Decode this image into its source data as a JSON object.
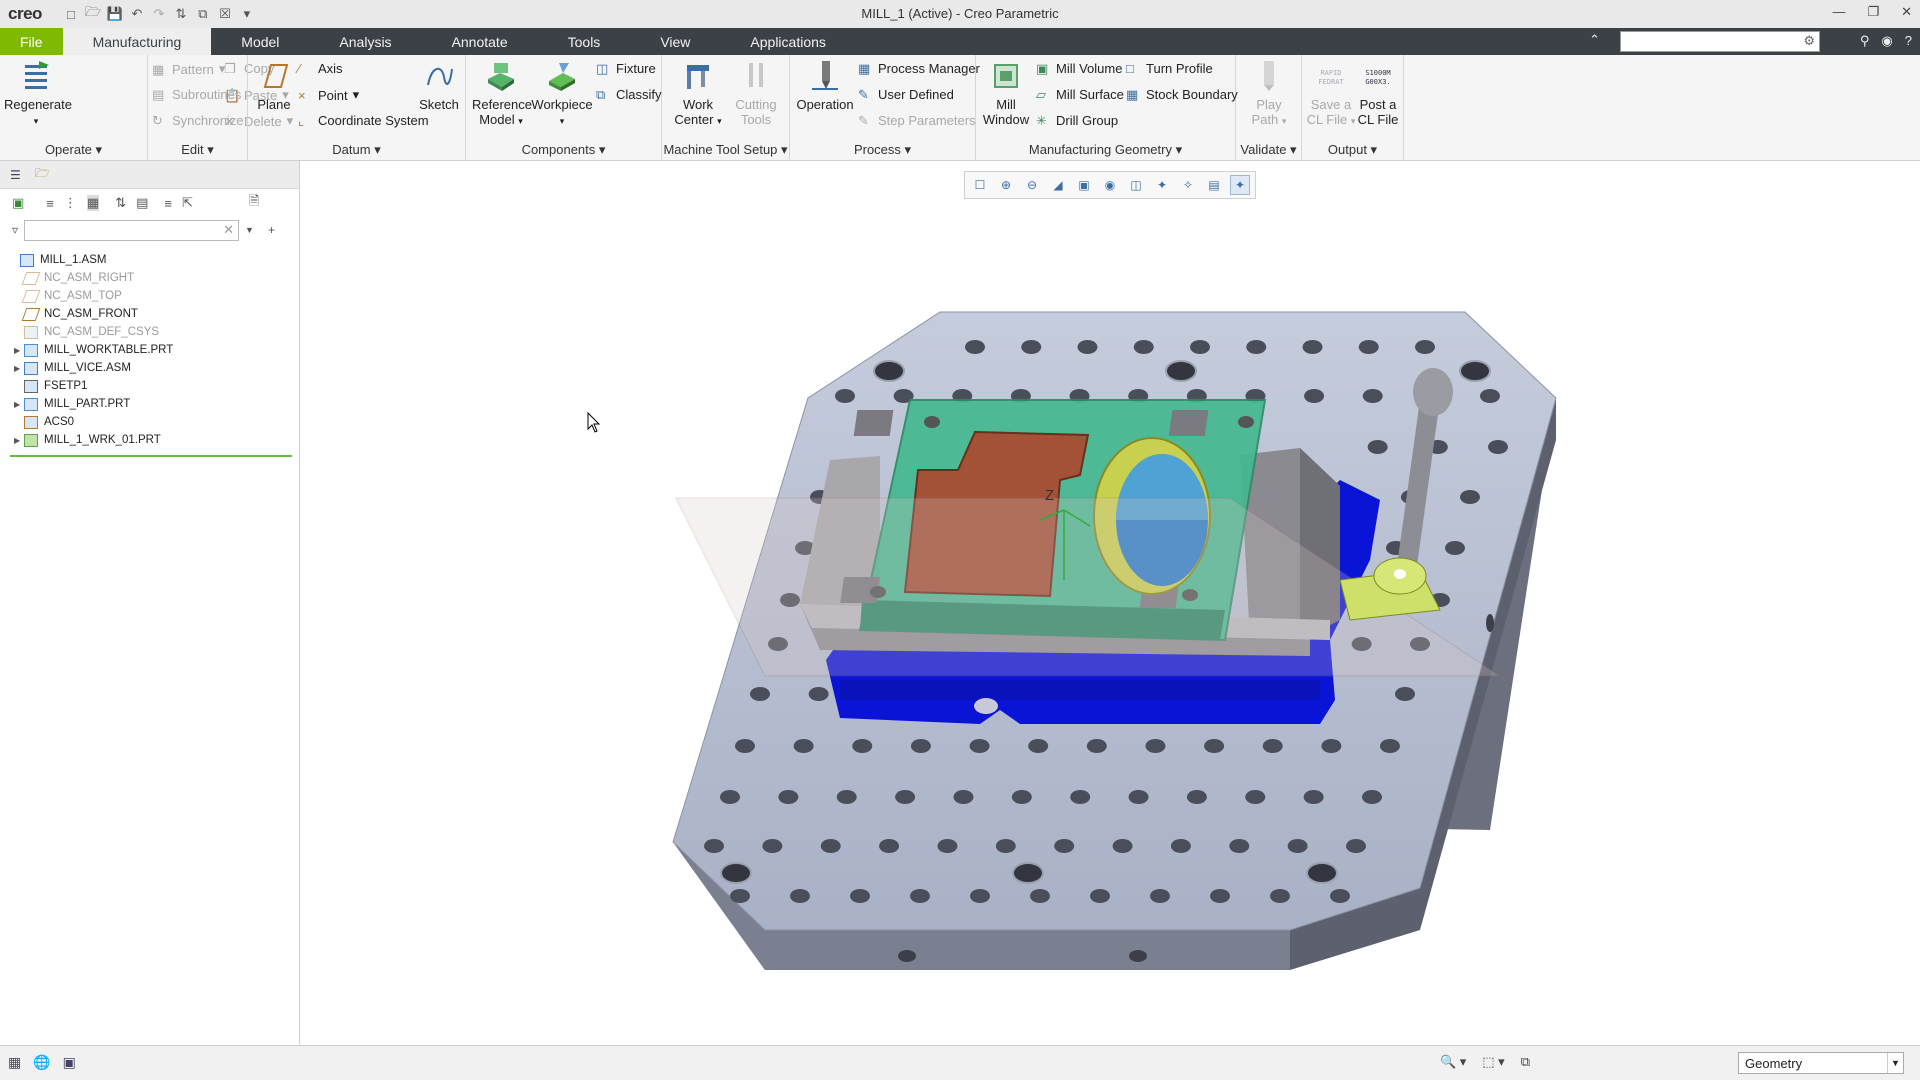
{
  "app": {
    "logo": "creo",
    "window_title": "MILL_1 (Active) - Creo Parametric"
  },
  "tabs": [
    "File",
    "Manufacturing",
    "Model",
    "Analysis",
    "Annotate",
    "Tools",
    "View",
    "Applications"
  ],
  "active_tab": "Manufacturing",
  "ribbon": {
    "operate": {
      "label": "Operate",
      "regenerate": "Regenerate"
    },
    "edit": {
      "label": "Edit",
      "copy": "Copy",
      "paste": "Paste",
      "delete": "Delete",
      "pattern": "Pattern",
      "subroutines": "Subroutines",
      "synchronize": "Synchronize"
    },
    "datum": {
      "label": "Datum",
      "plane": "Plane",
      "axis": "Axis",
      "point": "Point",
      "csys": "Coordinate System",
      "sketch": "Sketch"
    },
    "components": {
      "label": "Components",
      "reference_model_1": "Reference",
      "reference_model_2": "Model",
      "workpiece": "Workpiece",
      "fixture": "Fixture",
      "classify": "Classify"
    },
    "machine_tool_setup": {
      "label": "Machine Tool Setup",
      "work_center_1": "Work",
      "work_center_2": "Center",
      "cutting_tools_1": "Cutting",
      "cutting_tools_2": "Tools"
    },
    "process": {
      "label": "Process",
      "operation": "Operation",
      "process_manager": "Process Manager",
      "user_defined": "User Defined",
      "step_parameters": "Step Parameters"
    },
    "mfg_geometry": {
      "label": "Manufacturing Geometry",
      "mill_window_1": "Mill",
      "mill_window_2": "Window",
      "mill_volume": "Mill Volume",
      "mill_surface": "Mill Surface",
      "drill_group": "Drill Group",
      "turn_profile": "Turn Profile",
      "stock_boundary": "Stock Boundary"
    },
    "validate": {
      "label": "Validate",
      "play_path_1": "Play",
      "play_path_2": "Path"
    },
    "output": {
      "label": "Output",
      "save_cl_1": "Save a",
      "save_cl_2": "CL File",
      "post_cl_1": "Post a",
      "post_cl_2": "CL File",
      "save_icon_text_1": "RAPID",
      "save_icon_text_2": "FEDRAT",
      "post_icon_text_1": "S1000M",
      "post_icon_text_2": "G00X3."
    }
  },
  "model_tree": {
    "items": [
      {
        "label": "MILL_1.ASM",
        "level": 0,
        "expandable": false,
        "dim": false,
        "icon": "assembly-icon"
      },
      {
        "label": "NC_ASM_RIGHT",
        "level": 1,
        "expandable": false,
        "dim": true,
        "icon": "datum-plane-icon"
      },
      {
        "label": "NC_ASM_TOP",
        "level": 1,
        "expandable": false,
        "dim": true,
        "icon": "datum-plane-icon"
      },
      {
        "label": "NC_ASM_FRONT",
        "level": 1,
        "expandable": false,
        "dim": false,
        "icon": "datum-plane-icon"
      },
      {
        "label": "NC_ASM_DEF_CSYS",
        "level": 1,
        "expandable": false,
        "dim": true,
        "icon": "csys-icon"
      },
      {
        "label": "MILL_WORKTABLE.PRT",
        "level": 1,
        "expandable": true,
        "dim": false,
        "icon": "part-icon"
      },
      {
        "label": "MILL_VICE.ASM",
        "level": 1,
        "expandable": true,
        "dim": false,
        "icon": "assembly-icon"
      },
      {
        "label": "FSETP1",
        "level": 1,
        "expandable": false,
        "dim": false,
        "icon": "fixture-setup-icon"
      },
      {
        "label": "MILL_PART.PRT",
        "level": 1,
        "expandable": true,
        "dim": false,
        "icon": "part-icon"
      },
      {
        "label": "ACS0",
        "level": 1,
        "expandable": false,
        "dim": false,
        "icon": "csys-icon"
      },
      {
        "label": "MILL_1_WRK_01.PRT",
        "level": 1,
        "expandable": true,
        "dim": false,
        "icon": "workpiece-icon"
      }
    ]
  },
  "viewport": {
    "axis_label": "Z"
  },
  "status": {
    "selection_filter": "Geometry"
  },
  "colors": {
    "file_tab": "#7fba00",
    "tab_bar": "#3c4147",
    "table_top": "#b8c0d4",
    "vice_base": "#0a14d6",
    "workpiece": "#44b890"
  }
}
